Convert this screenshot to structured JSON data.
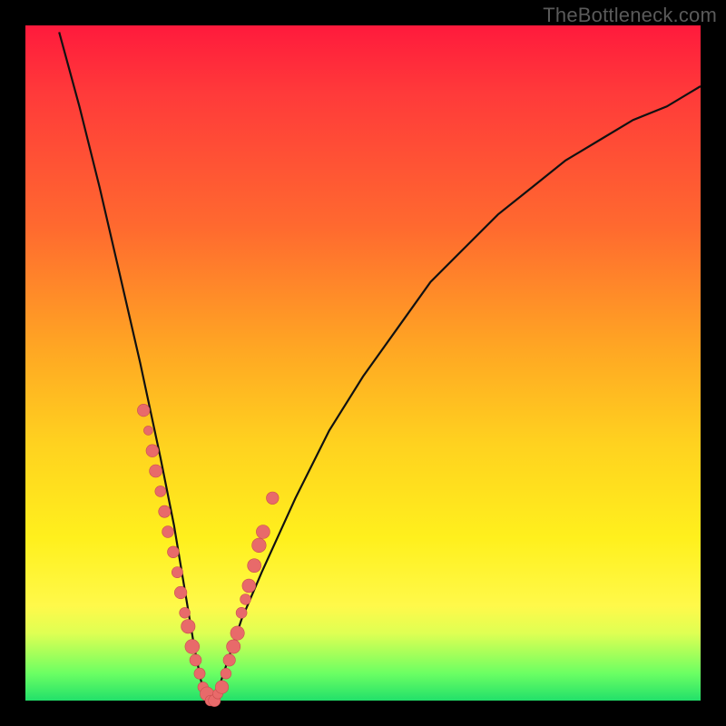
{
  "watermark": "TheBottleneck.com",
  "colors": {
    "frame": "#000000",
    "gradient_top": "#ff1a3c",
    "gradient_mid": "#fff01d",
    "gradient_bottom": "#22e06a",
    "curve": "#111111",
    "dot_fill": "#e86a6a",
    "dot_stroke": "#c94e4e"
  },
  "chart_data": {
    "type": "line",
    "title": "",
    "xlabel": "",
    "ylabel": "",
    "xlim": [
      0,
      100
    ],
    "ylim": [
      0,
      100
    ],
    "grid": false,
    "note": "Single V-shaped bottleneck curve. y represents bottleneck percentage (higher = worse, red zone at top; 0 = optimal, green band at bottom). Minimum near x≈27 where y≈0.",
    "series": [
      {
        "name": "bottleneck-curve",
        "x": [
          5,
          8,
          11,
          14,
          17,
          20,
          22,
          24,
          25,
          26,
          27,
          28,
          29,
          30,
          32,
          35,
          40,
          45,
          50,
          55,
          60,
          65,
          70,
          75,
          80,
          85,
          90,
          95,
          100
        ],
        "y": [
          99,
          88,
          76,
          63,
          50,
          36,
          26,
          14,
          8,
          3,
          0,
          0,
          3,
          6,
          12,
          19,
          30,
          40,
          48,
          55,
          62,
          67,
          72,
          76,
          80,
          83,
          86,
          88,
          91
        ]
      }
    ],
    "points_overlay": {
      "name": "sample-dots",
      "note": "Pink scatter dots clustered on the lower part of both arms of the V-curve and in the trough.",
      "x": [
        17.5,
        18.2,
        18.8,
        19.3,
        20.0,
        20.6,
        21.1,
        21.9,
        22.5,
        23.0,
        23.6,
        24.1,
        24.7,
        25.2,
        25.8,
        26.3,
        26.9,
        27.4,
        28.0,
        28.5,
        29.1,
        29.7,
        30.2,
        30.8,
        31.4,
        32.0,
        32.6,
        33.1,
        33.9,
        34.6,
        35.2,
        36.6
      ],
      "y": [
        43,
        40,
        37,
        34,
        31,
        28,
        25,
        22,
        19,
        16,
        13,
        11,
        8,
        6,
        4,
        2,
        1,
        0,
        0,
        1,
        2,
        4,
        6,
        8,
        10,
        13,
        15,
        17,
        20,
        23,
        25,
        30
      ]
    }
  }
}
